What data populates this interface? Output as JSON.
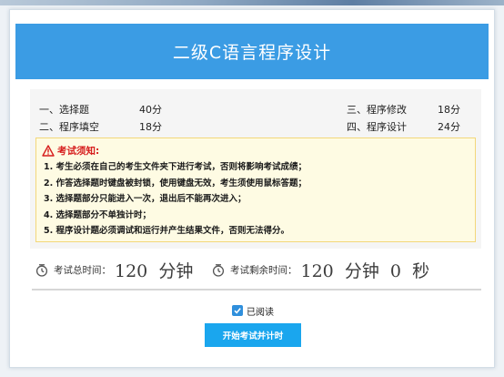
{
  "header": {
    "title": "二级C语言程序设计"
  },
  "sections": [
    {
      "name": "一、选择题",
      "score": "40分"
    },
    {
      "name": "三、程序修改",
      "score": "18分"
    },
    {
      "name": "二、程序填空",
      "score": "18分"
    },
    {
      "name": "四、程序设计",
      "score": "24分"
    }
  ],
  "notice": {
    "title": "考试须知:",
    "items": [
      "1. 考生必须在自己的考生文件夹下进行考试，否则将影响考试成绩；",
      "2. 作答选择题时键盘被封锁，使用键盘无效，考生须使用鼠标答题；",
      "3. 选择题部分只能进入一次，退出后不能再次进入；",
      "4. 选择题部分不单独计时；",
      "5. 程序设计题必须调试和运行并产生结果文件，否则无法得分。"
    ]
  },
  "timers": {
    "total_label": "考试总时间：",
    "total_value": "120  分钟",
    "remaining_label": "考试剩余时间：",
    "remaining_value": "120  分钟  0  秒"
  },
  "confirm": {
    "read_label": "已阅读",
    "checked": true
  },
  "start_button": {
    "label": "开始考试并计时"
  },
  "colors": {
    "header_bg": "#3b9ce4",
    "notice_title": "#d61c1c",
    "button_bg": "#1aa6ee"
  },
  "icons": [
    "warning-icon",
    "clock-icon",
    "checkbox-checked-icon"
  ]
}
